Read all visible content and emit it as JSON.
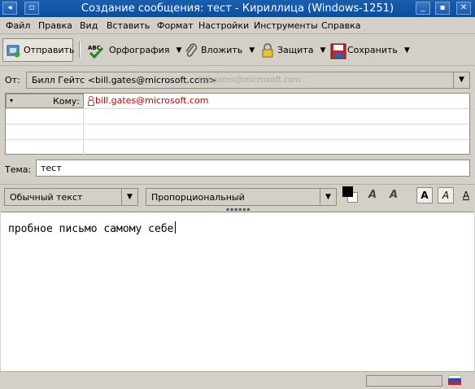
{
  "window": {
    "title": "Создание сообщения: тест - Кириллица (Windows-1251)",
    "controls": [
      "◂",
      "▫",
      "_",
      "▪",
      "✕"
    ]
  },
  "menu": {
    "items": [
      {
        "label": "Файл"
      },
      {
        "label": "Правка"
      },
      {
        "label": "Вид"
      },
      {
        "label": "Вставить"
      },
      {
        "label": "Формат"
      },
      {
        "label": "Настройки"
      },
      {
        "label": "Инструменты"
      },
      {
        "label": "Справка"
      }
    ]
  },
  "toolbar": {
    "send": "Отправить",
    "spell": "Орфография",
    "attach": "Вложить",
    "security": "Защита",
    "save": "Сохранить",
    "spell_icon_text": "ABC"
  },
  "from": {
    "label": "От:",
    "value": "Билл Гейтс <bill.gates@microsoft.com>",
    "ghost": "bill.gates@microsoft.com"
  },
  "recipients": {
    "type_label": "Кому:",
    "rows": [
      {
        "address": "bill.gates@microsoft.com"
      }
    ]
  },
  "subject": {
    "label": "Тема:",
    "value": "тест"
  },
  "format": {
    "paragraph": "Обычный текст",
    "font": "Пропорциональный",
    "btn_a1": "A",
    "btn_a2": "A",
    "btn_a3": "A",
    "btn_a4": "A",
    "btn_a5": "A",
    "colors": {
      "text": "#000000",
      "background": "#ffffff"
    }
  },
  "body": {
    "text": "пробное письмо самому себе"
  },
  "colors": {
    "titlebar": "#0a4da0",
    "address": "#cc0000"
  }
}
